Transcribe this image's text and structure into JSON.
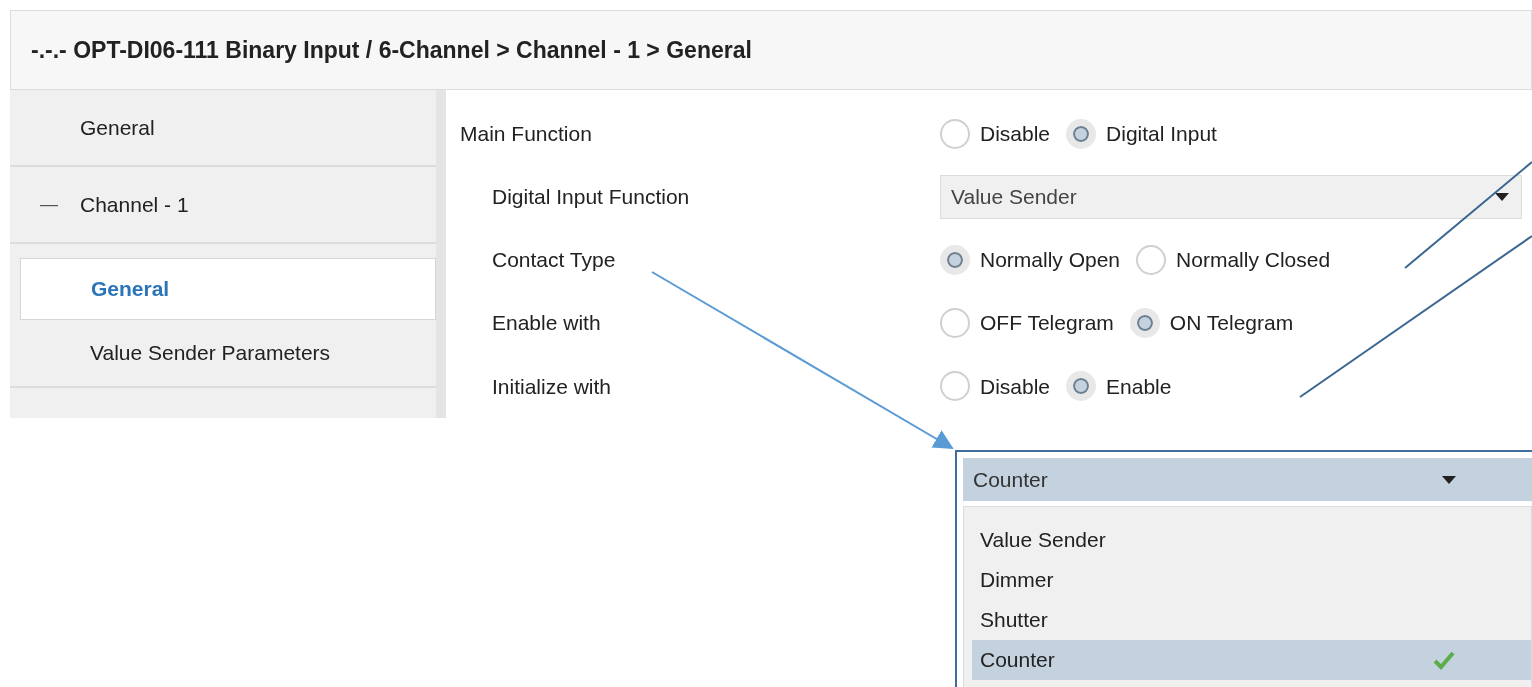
{
  "breadcrumb": "-.-.- OPT-DI06-111 Binary Input / 6-Channel > Channel - 1 > General",
  "sidebar": {
    "items": [
      {
        "label": "General",
        "selected": false
      },
      {
        "label": "Channel - 1",
        "selected": false,
        "expander": "—",
        "children": [
          {
            "label": "General",
            "selected": true
          },
          {
            "label": "Value Sender Parameters",
            "selected": false
          }
        ]
      }
    ]
  },
  "parameters": [
    {
      "label": "Main Function",
      "kind": "radio",
      "indented": false,
      "options": [
        {
          "label": "Disable",
          "selected": false
        },
        {
          "label": "Digital Input",
          "selected": true
        }
      ]
    },
    {
      "label": "Digital Input Function",
      "kind": "dropdown",
      "indented": true,
      "value": "Value Sender"
    },
    {
      "label": "Contact Type",
      "kind": "radio",
      "indented": true,
      "options": [
        {
          "label": "Normally Open",
          "selected": true
        },
        {
          "label": "Normally Closed",
          "selected": false
        }
      ]
    },
    {
      "label": "Enable with",
      "kind": "radio",
      "indented": true,
      "options": [
        {
          "label": "OFF Telegram",
          "selected": false
        },
        {
          "label": "ON Telegram",
          "selected": true
        }
      ]
    },
    {
      "label": "Initialize with",
      "kind": "radio",
      "indented": true,
      "options": [
        {
          "label": "Disable",
          "selected": false
        },
        {
          "label": "Enable",
          "selected": true
        }
      ]
    }
  ],
  "dropdown_popup": {
    "value": "Counter",
    "options": [
      {
        "label": "Value Sender",
        "selected": false
      },
      {
        "label": "Dimmer",
        "selected": false
      },
      {
        "label": "Shutter",
        "selected": false
      },
      {
        "label": "Counter",
        "selected": true
      }
    ]
  }
}
